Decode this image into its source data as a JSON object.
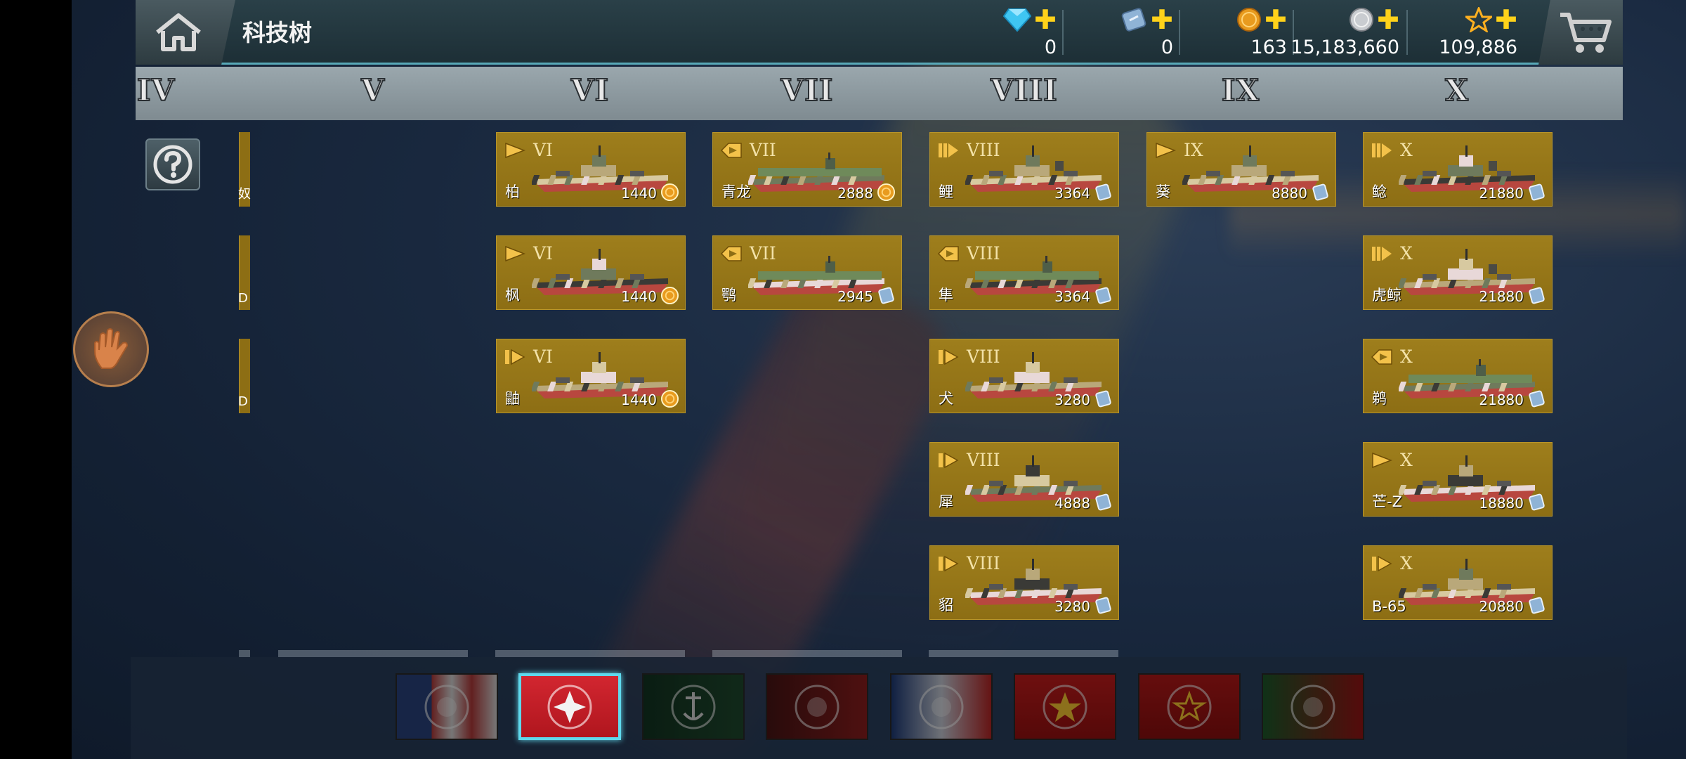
{
  "header": {
    "title": "科技树",
    "home_icon": "home-icon",
    "cart_icon": "cart-icon"
  },
  "currencies": [
    {
      "name": "diamond",
      "value": "0",
      "color": "#3fc6f2"
    },
    {
      "name": "silver-ticket",
      "value": "0",
      "color": "#8fb3d6"
    },
    {
      "name": "gold-coin",
      "value": "163",
      "color": "#e89b1e"
    },
    {
      "name": "silver-coin",
      "value": "15,183,660",
      "color": "#c9ccd0"
    },
    {
      "name": "star",
      "value": "109,886",
      "color": "#ffb020"
    }
  ],
  "tiers": [
    "IV",
    "V",
    "VI",
    "VII",
    "VIII",
    "IX",
    "X"
  ],
  "partial_cards": [
    {
      "label": "奴"
    },
    {
      "label": "D"
    },
    {
      "label": "D"
    }
  ],
  "ships": [
    {
      "tier": "VI",
      "name": "柏",
      "price": "1440",
      "currency": "gold",
      "cls": "destroyer"
    },
    {
      "tier": "VI",
      "name": "枫",
      "price": "1440",
      "currency": "gold",
      "cls": "destroyer"
    },
    {
      "tier": "VI",
      "name": "鼬",
      "price": "1440",
      "currency": "gold",
      "cls": "cruiser"
    },
    {
      "tier": "VII",
      "name": "青龙",
      "price": "2888",
      "currency": "gold",
      "cls": "carrier"
    },
    {
      "tier": "VII",
      "name": "鹗",
      "price": "2945",
      "currency": "silver",
      "cls": "carrier"
    },
    {
      "tier": "VIII",
      "name": "鲤",
      "price": "3364",
      "currency": "silver",
      "cls": "battleship"
    },
    {
      "tier": "VIII",
      "name": "隼",
      "price": "3364",
      "currency": "silver",
      "cls": "carrier"
    },
    {
      "tier": "VIII",
      "name": "犬",
      "price": "3280",
      "currency": "silver",
      "cls": "cruiser"
    },
    {
      "tier": "VIII",
      "name": "犀",
      "price": "4888",
      "currency": "silver",
      "cls": "cruiser"
    },
    {
      "tier": "VIII",
      "name": "貂",
      "price": "3280",
      "currency": "silver",
      "cls": "cruiser"
    },
    {
      "tier": "IX",
      "name": "葵",
      "price": "8880",
      "currency": "silver",
      "cls": "destroyer"
    },
    {
      "tier": "X",
      "name": "鲶",
      "price": "21880",
      "currency": "silver",
      "cls": "battleship"
    },
    {
      "tier": "X",
      "name": "虎鲸",
      "price": "21880",
      "currency": "silver",
      "cls": "battleship"
    },
    {
      "tier": "X",
      "name": "鹈",
      "price": "21880",
      "currency": "silver",
      "cls": "carrier"
    },
    {
      "tier": "X",
      "name": "芒-Z",
      "price": "18880",
      "currency": "silver",
      "cls": "destroyer"
    },
    {
      "tier": "X",
      "name": "B-65",
      "price": "20880",
      "currency": "silver",
      "cls": "cruiser"
    }
  ],
  "nations": [
    {
      "name": "usa",
      "selected": false
    },
    {
      "name": "japan",
      "selected": true
    },
    {
      "name": "germany",
      "selected": false
    },
    {
      "name": "uk",
      "selected": false
    },
    {
      "name": "france",
      "selected": false
    },
    {
      "name": "ussr",
      "selected": false
    },
    {
      "name": "china",
      "selected": false
    },
    {
      "name": "italy",
      "selected": false
    }
  ]
}
